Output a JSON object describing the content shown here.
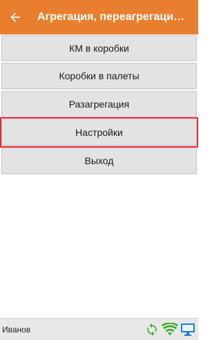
{
  "header": {
    "title": "Агрегация, переагрегация,...",
    "back_icon": "arrow-left-icon",
    "background_color": "#e97f2e"
  },
  "menu": {
    "items": [
      {
        "label": "КМ в коробки"
      },
      {
        "label": "Коробки в палеты"
      },
      {
        "label": "Разагрегация"
      },
      {
        "label": "Настройки",
        "highlighted": true
      },
      {
        "label": "Выход"
      }
    ],
    "highlight_color": "#e8263a"
  },
  "statusbar": {
    "user": "Иванов",
    "icons": [
      "sync-icon",
      "wifi-icon",
      "monitor-icon"
    ],
    "sync_color": "#3fae2a",
    "wifi_color": "#3fae2a",
    "monitor_color": "#1f7fc7"
  }
}
